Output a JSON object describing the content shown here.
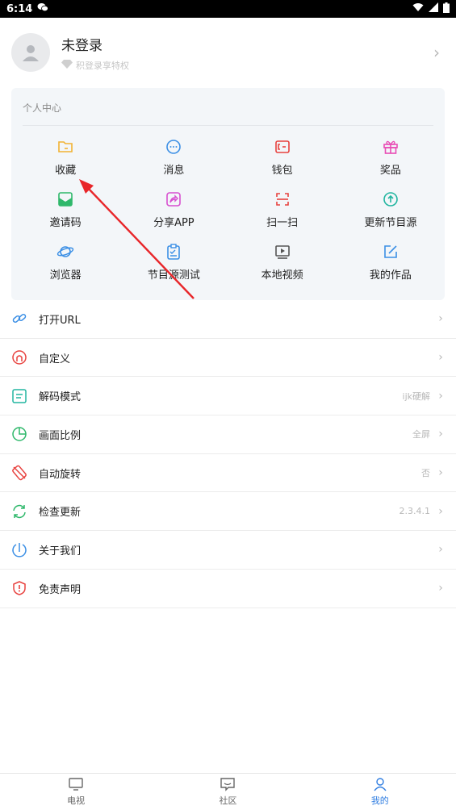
{
  "status_bar": {
    "time": "6:14"
  },
  "profile": {
    "name": "未登录",
    "subtitle": "积登录享特权"
  },
  "personal_center": {
    "title": "个人中心",
    "items": [
      {
        "label": "收藏",
        "icon": "folder-icon",
        "color": "#f2b233"
      },
      {
        "label": "消息",
        "icon": "chat-bubble-icon",
        "color": "#3b8fe5"
      },
      {
        "label": "钱包",
        "icon": "wallet-icon",
        "color": "#e8423f"
      },
      {
        "label": "奖品",
        "icon": "gift-icon",
        "color": "#e84bb5"
      },
      {
        "label": "邀请码",
        "icon": "mail-icon",
        "color": "#2fb86b"
      },
      {
        "label": "分享APP",
        "icon": "share-icon",
        "color": "#d84fd0"
      },
      {
        "label": "扫一扫",
        "icon": "scan-icon",
        "color": "#e8423f"
      },
      {
        "label": "更新节目源",
        "icon": "upload-circle-icon",
        "color": "#22b5a0"
      },
      {
        "label": "浏览器",
        "icon": "planet-icon",
        "color": "#3b8fe5"
      },
      {
        "label": "节目源测试",
        "icon": "clipboard-check-icon",
        "color": "#3b8fe5"
      },
      {
        "label": "本地视频",
        "icon": "video-play-icon",
        "color": "#555555"
      },
      {
        "label": "我的作品",
        "icon": "edit-icon",
        "color": "#3b8fe5"
      }
    ]
  },
  "settings": [
    {
      "label": "打开URL",
      "value": "",
      "icon": "link-icon",
      "color": "#3b8fe5"
    },
    {
      "label": "自定义",
      "value": "",
      "icon": "custom-icon",
      "color": "#e8423f"
    },
    {
      "label": "解码模式",
      "value": "ijk硬解",
      "icon": "decode-icon",
      "color": "#22b5a0"
    },
    {
      "label": "画面比例",
      "value": "全屏",
      "icon": "pie-chart-icon",
      "color": "#2fb86b"
    },
    {
      "label": "自动旋转",
      "value": "否",
      "icon": "rotate-icon",
      "color": "#e8423f"
    },
    {
      "label": "检查更新",
      "value": "2.3.4.1",
      "icon": "refresh-icon",
      "color": "#2fb86b"
    },
    {
      "label": "关于我们",
      "value": "",
      "icon": "info-icon",
      "color": "#3b8fe5"
    },
    {
      "label": "免责声明",
      "value": "",
      "icon": "shield-alert-icon",
      "color": "#e8423f"
    }
  ],
  "tabs": [
    {
      "label": "电视",
      "icon": "tv-icon"
    },
    {
      "label": "社区",
      "icon": "community-icon"
    },
    {
      "label": "我的",
      "icon": "user-icon",
      "active": true
    }
  ],
  "accent_color": "#2f7de1"
}
